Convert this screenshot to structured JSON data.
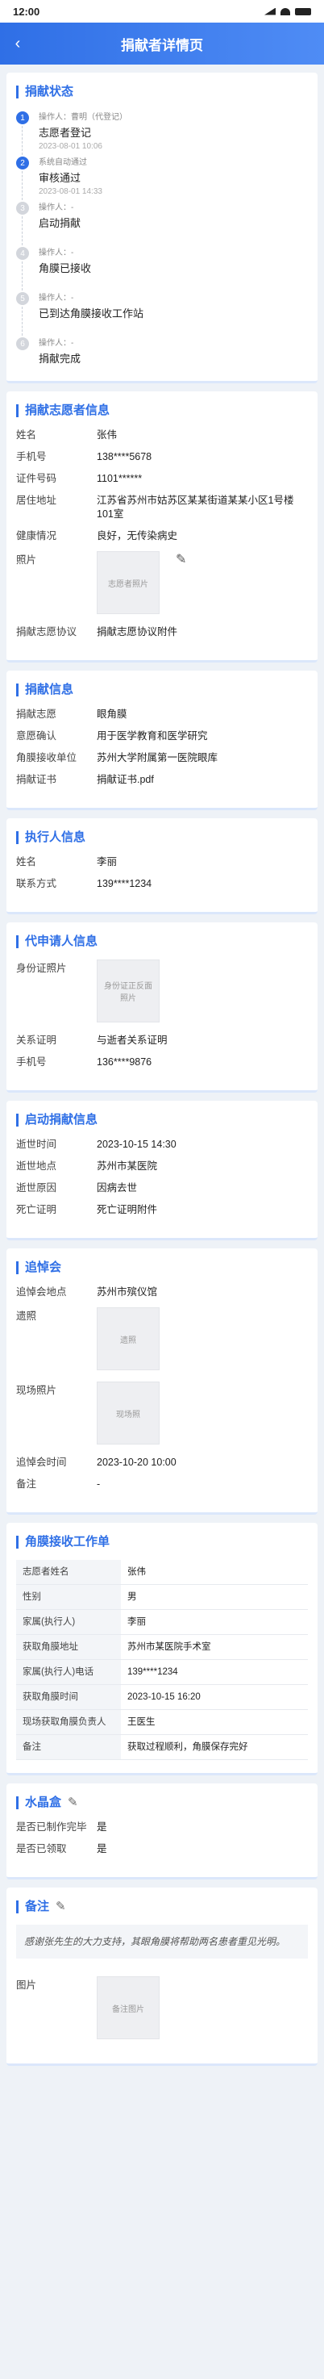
{
  "status_bar": {
    "time": "12:00"
  },
  "nav": {
    "back": "‹",
    "title": "捐献者详情页"
  },
  "status": {
    "title": "捐献状态",
    "steps": [
      {
        "num": "1",
        "op": "操作人：曹明（代登记）",
        "status": "志愿者登记",
        "time": "2023-08-01 10:06"
      },
      {
        "num": "2",
        "op": "系统自动通过",
        "status": "审核通过",
        "time": "2023-08-01 14:33"
      },
      {
        "num": "3",
        "op": "操作人：-",
        "status": "启动捐献",
        "time": ""
      },
      {
        "num": "4",
        "op": "操作人：-",
        "status": "角膜已接收",
        "time": ""
      },
      {
        "num": "5",
        "op": "操作人：-",
        "status": "已到达角膜接收工作站",
        "time": ""
      },
      {
        "num": "6",
        "op": "操作人：-",
        "status": "捐献完成",
        "time": ""
      }
    ]
  },
  "volunteer": {
    "title": "捐献志愿者信息",
    "name_k": "姓名",
    "name_v": "张伟",
    "phone_k": "手机号",
    "phone_v": "138****5678",
    "id_k": "证件号码",
    "id_v": "1101******",
    "addr_k": "居住地址",
    "addr_v": "江苏省苏州市姑苏区某某街道某某小区1号楼101室",
    "health_k": "健康情况",
    "health_v": "良好，无传染病史",
    "photo_k": "照片",
    "photo_ph": "志愿者照片",
    "agreement_k": "捐献志愿协议",
    "agreement_v": "捐献志愿协议附件"
  },
  "donation": {
    "title": "捐献信息",
    "organ_k": "捐献志愿",
    "organ_v": "眼角膜",
    "intent_k": "意愿确认",
    "intent_v": "用于医学教育和医学研究",
    "unit_k": "角膜接收单位",
    "unit_v": "苏州大学附属第一医院眼库",
    "cert_k": "捐献证书",
    "cert_v": "捐献证书.pdf"
  },
  "executor": {
    "title": "执行人信息",
    "name_k": "姓名",
    "name_v": "李丽",
    "contact_k": "联系方式",
    "contact_v": "139****1234"
  },
  "applicant": {
    "title": "代申请人信息",
    "idphoto_k": "身份证照片",
    "idphoto_ph": "身份证正反面照片",
    "relation_k": "关系证明",
    "relation_v": "与逝者关系证明",
    "phone_k": "手机号",
    "phone_v": "136****9876"
  },
  "start": {
    "title": "启动捐献信息",
    "time_k": "逝世时间",
    "time_v": "2023-10-15 14:30",
    "place_k": "逝世地点",
    "place_v": "苏州市某医院",
    "reason_k": "逝世原因",
    "reason_v": "因病去世",
    "cert_k": "死亡证明",
    "cert_v": "死亡证明附件"
  },
  "memorial": {
    "title": "追悼会",
    "place_k": "追悼会地点",
    "place_v": "苏州市殡仪馆",
    "portrait_k": "遗照",
    "portrait_ph": "遗照",
    "scene_k": "现场照片",
    "scene_ph": "现场照",
    "time_k": "追悼会时间",
    "time_v": "2023-10-20 10:00",
    "remark_k": "备注",
    "remark_v": "-"
  },
  "workstation": {
    "title": "角膜接收工作单",
    "rows": [
      {
        "k": "志愿者姓名",
        "v": "张伟"
      },
      {
        "k": "性别",
        "v": "男"
      },
      {
        "k": "家属(执行人)",
        "v": "李丽"
      },
      {
        "k": "获取角膜地址",
        "v": "苏州市某医院手术室"
      },
      {
        "k": "家属(执行人)电话",
        "v": "139****1234"
      },
      {
        "k": "获取角膜时间",
        "v": "2023-10-15 16:20"
      },
      {
        "k": "现场获取角膜负责人",
        "v": "王医生"
      },
      {
        "k": "备注",
        "v": "获取过程顺利，角膜保存完好"
      }
    ]
  },
  "crystal": {
    "title": "水晶盒",
    "made_k": "是否已制作完毕",
    "made_v": "是",
    "received_k": "是否已领取",
    "received_v": "是"
  },
  "remark": {
    "title": "备注",
    "text": "感谢张先生的大力支持，其眼角膜将帮助两名患者重见光明。",
    "photo_k": "图片",
    "photo_ph": "备注图片"
  }
}
